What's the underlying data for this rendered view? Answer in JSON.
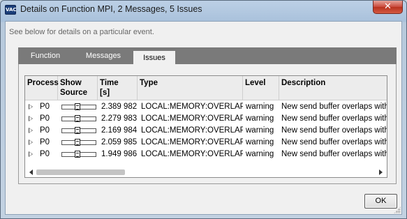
{
  "window": {
    "app_icon": "VAC",
    "title": "Details on Function MPI, 2 Messages, 5 Issues",
    "close_label": "✕"
  },
  "hint": "See below for details on a particular event.",
  "tabs": [
    {
      "label": "Function",
      "active": false
    },
    {
      "label": "Messages",
      "active": false
    },
    {
      "label": "Issues",
      "active": true
    }
  ],
  "table": {
    "columns": [
      {
        "label": "Process"
      },
      {
        "label": "Show\nSource"
      },
      {
        "label": "Time\n[s]"
      },
      {
        "label": "Type"
      },
      {
        "label": "Level"
      },
      {
        "label": "Description"
      }
    ],
    "rows": [
      {
        "process": "P0",
        "time": "2.389 982",
        "type": "LOCAL:MEMORY:OVERLAP",
        "level": "warning",
        "description": "New send buffer overlaps with"
      },
      {
        "process": "P0",
        "time": "2.279 983",
        "type": "LOCAL:MEMORY:OVERLAP",
        "level": "warning",
        "description": "New send buffer overlaps with"
      },
      {
        "process": "P0",
        "time": "2.169 984",
        "type": "LOCAL:MEMORY:OVERLAP",
        "level": "warning",
        "description": "New send buffer overlaps with"
      },
      {
        "process": "P0",
        "time": "2.059 985",
        "type": "LOCAL:MEMORY:OVERLAP",
        "level": "warning",
        "description": "New send buffer overlaps with"
      },
      {
        "process": "P0",
        "time": "1.949 986",
        "type": "LOCAL:MEMORY:OVERLAP",
        "level": "warning",
        "description": "New send buffer overlaps with"
      }
    ]
  },
  "ok_label": "OK",
  "icons": {
    "expander": "triangle-right-icon",
    "source": "document-icon"
  }
}
